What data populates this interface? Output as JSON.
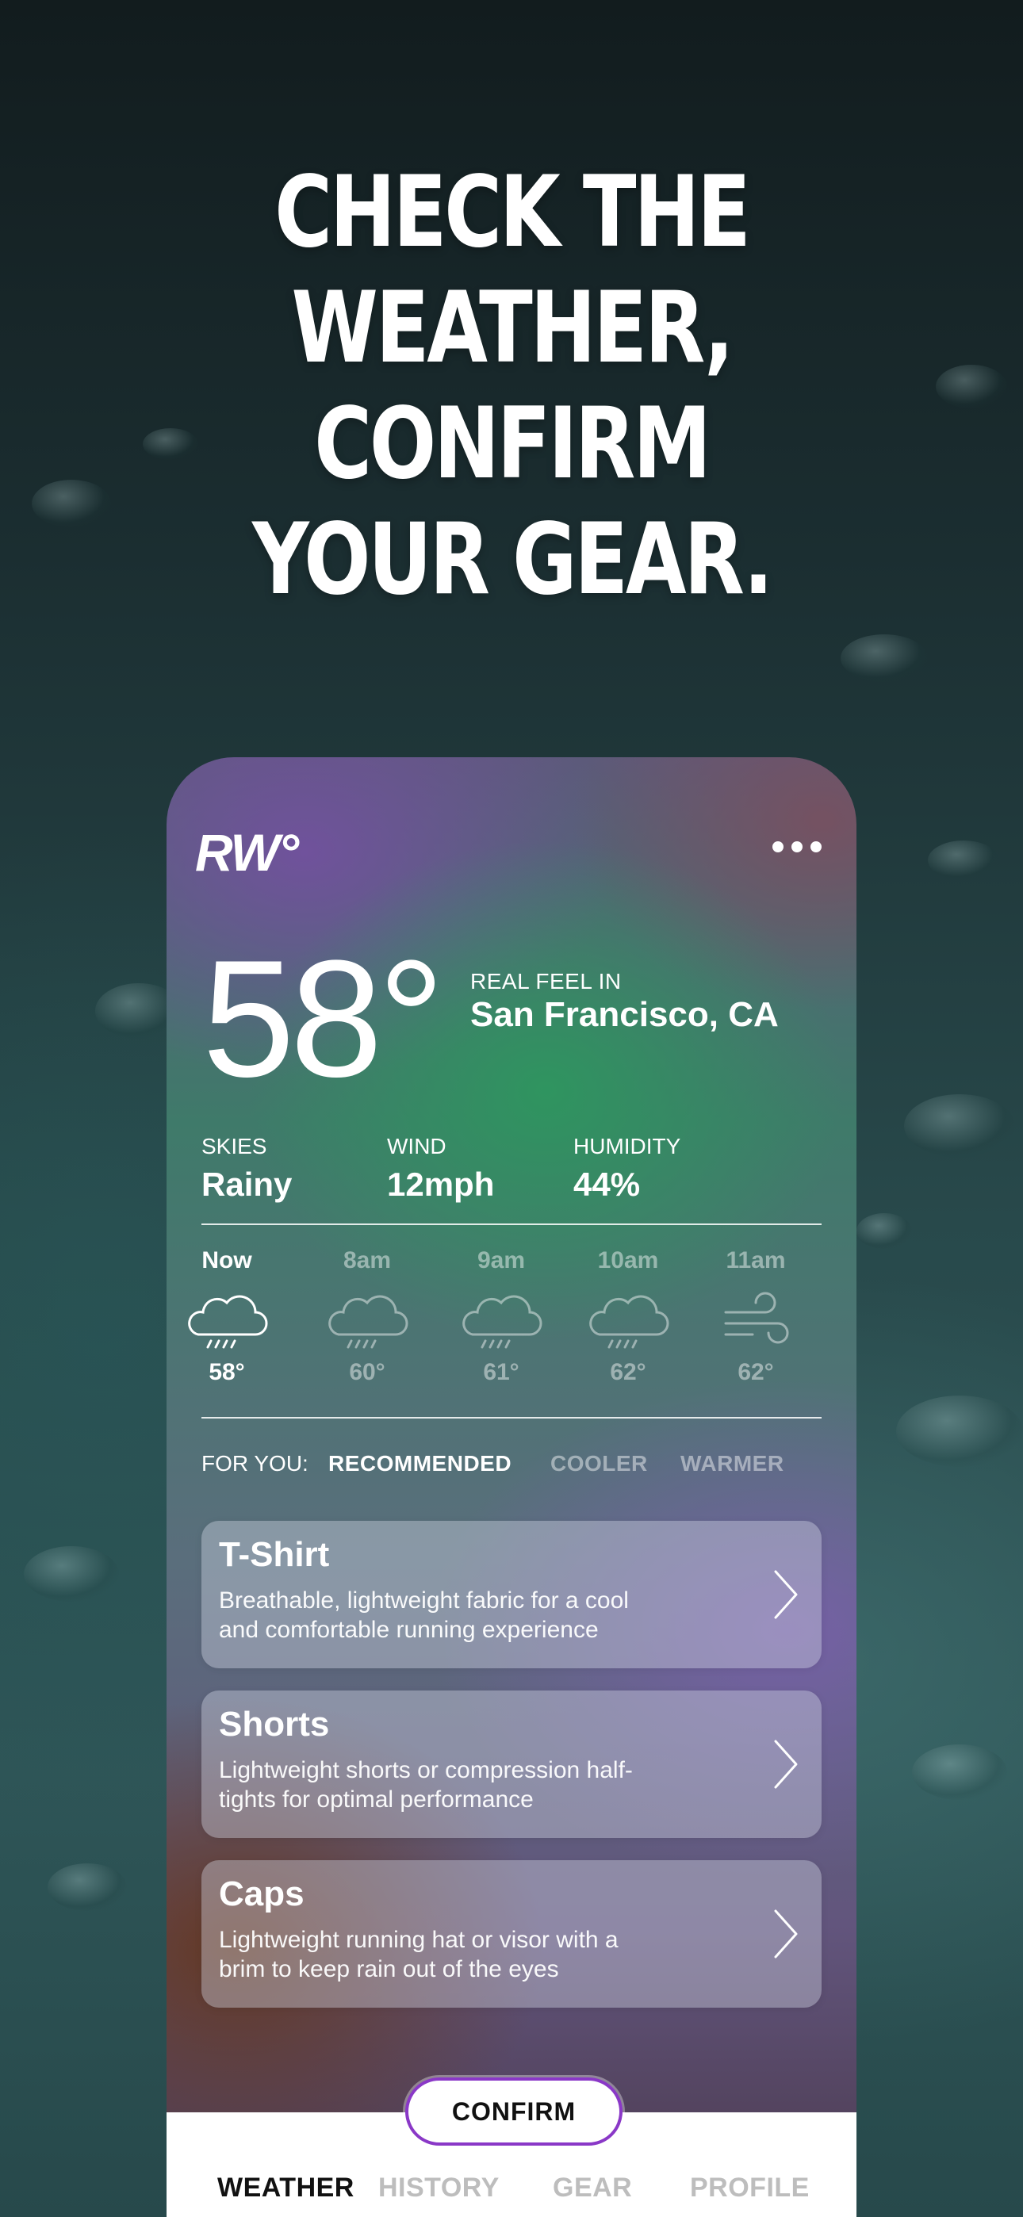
{
  "headline": {
    "line1": "CHECK THE",
    "line2": "WEATHER,",
    "line3": "CONFIRM",
    "line4": "YOUR GEAR."
  },
  "app": {
    "logo": "RW°",
    "menu_icon": "more-dots-icon"
  },
  "current": {
    "temperature": "58°",
    "real_feel_label": "REAL FEEL IN",
    "location": "San Francisco,  CA"
  },
  "stats": [
    {
      "label": "SKIES",
      "value": "Rainy"
    },
    {
      "label": "WIND",
      "value": "12mph"
    },
    {
      "label": "HUMIDITY",
      "value": "44%"
    }
  ],
  "hourly": [
    {
      "time": "Now",
      "icon": "rain-cloud-icon",
      "temp": "58°"
    },
    {
      "time": "8am",
      "icon": "rain-cloud-icon",
      "temp": "60°"
    },
    {
      "time": "9am",
      "icon": "rain-cloud-icon",
      "temp": "61°"
    },
    {
      "time": "10am",
      "icon": "rain-cloud-icon",
      "temp": "62°"
    },
    {
      "time": "11am",
      "icon": "wind-icon",
      "temp": "62°"
    }
  ],
  "filters": {
    "label": "FOR YOU:",
    "options": [
      "RECOMMENDED",
      "COOLER",
      "WARMER"
    ],
    "selected": "RECOMMENDED"
  },
  "gear": [
    {
      "title": "T-Shirt",
      "line1": "Breathable, lightweight fabric for a cool",
      "line2": "and comfortable running experience"
    },
    {
      "title": "Shorts",
      "line1": "Lightweight shorts or compression half-",
      "line2": "tights for optimal performance"
    },
    {
      "title": "Caps",
      "line1": "Lightweight running hat or visor with a",
      "line2": "brim to keep rain out of the eyes"
    }
  ],
  "confirm_label": "CONFIRM",
  "tabs": [
    "WEATHER",
    "HISTORY",
    "GEAR",
    "PROFILE"
  ],
  "active_tab": "WEATHER",
  "colors": {
    "accent_border": "#8a38c7",
    "tab_inactive": "#bdbdbd",
    "tab_active": "#111111"
  }
}
